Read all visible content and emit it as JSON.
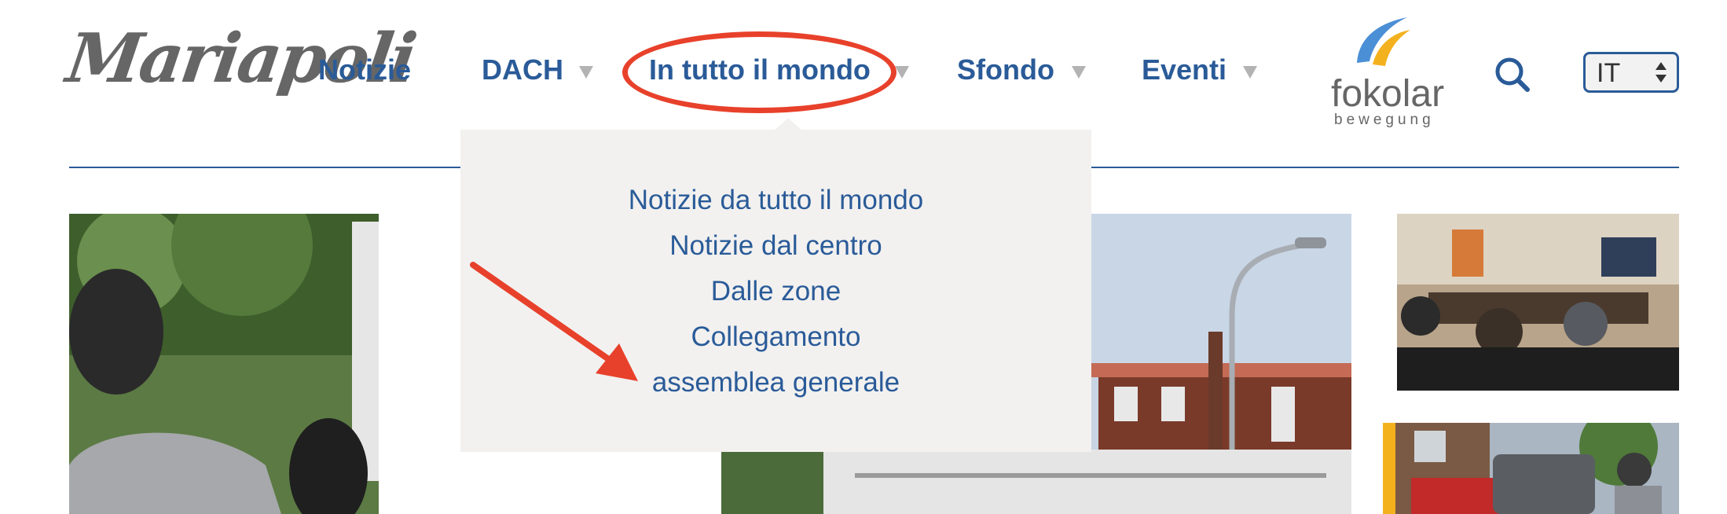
{
  "logo": {
    "text": "Mariapoli"
  },
  "nav": {
    "items": [
      {
        "label": "Notizie"
      },
      {
        "label": "DACH"
      },
      {
        "label": "In tutto il mondo"
      },
      {
        "label": "Sfondo"
      },
      {
        "label": "Eventi"
      }
    ]
  },
  "brand": {
    "name": "fokolar",
    "sub": "bewegung"
  },
  "language": {
    "selected": "IT"
  },
  "dropdown": {
    "items": [
      {
        "label": "Notizie da tutto il mondo"
      },
      {
        "label": "Notizie dal centro"
      },
      {
        "label": "Dalle zone"
      },
      {
        "label": "Collegamento"
      },
      {
        "label": "assemblea generale"
      }
    ]
  },
  "colors": {
    "nav_blue": "#2a5b98",
    "annotation_red": "#e8412b",
    "dropdown_bg": "#f2f1f0",
    "accent_yellow": "#f4b11e"
  },
  "icons": {
    "search": "search-icon",
    "caret": "caret-down-icon",
    "select_arrows": "updown-arrows-icon"
  }
}
